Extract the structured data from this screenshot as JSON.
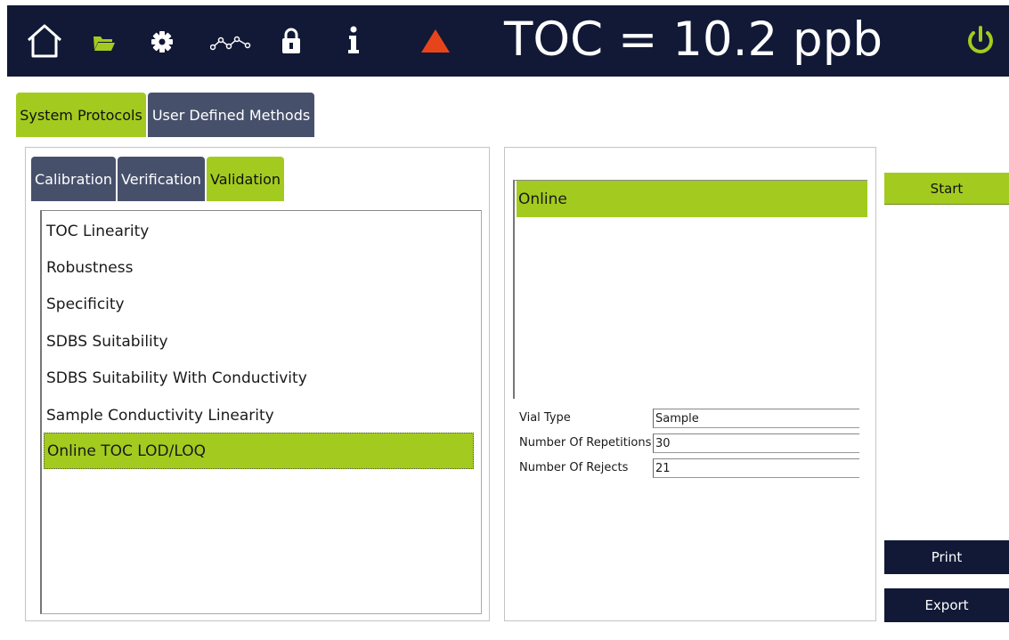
{
  "header": {
    "title": "TOC = 10.2 ppb",
    "icons": [
      "home-icon",
      "folder-icon",
      "gear-icon",
      "trend-icon",
      "lock-icon",
      "info-icon",
      "alert-triangle-icon",
      "power-icon"
    ],
    "colors": {
      "bar": "#111936",
      "accent": "#a3cb1f",
      "alert": "#e8441b"
    }
  },
  "main_tabs": [
    {
      "label": "System Protocols",
      "active": true
    },
    {
      "label": "User Defined Methods",
      "active": false
    }
  ],
  "sub_tabs": [
    {
      "label": "Calibration",
      "active": false
    },
    {
      "label": "Verification",
      "active": false
    },
    {
      "label": "Validation",
      "active": true
    }
  ],
  "protocols": [
    {
      "label": "TOC Linearity"
    },
    {
      "label": "Robustness"
    },
    {
      "label": "Specificity"
    },
    {
      "label": "SDBS Suitability"
    },
    {
      "label": "SDBS Suitability With Conductivity"
    },
    {
      "label": "Sample Conductivity Linearity"
    },
    {
      "label": "Online TOC LOD/LOQ",
      "selected": true
    }
  ],
  "methods": [
    {
      "label": "Online",
      "selected": true
    }
  ],
  "params": [
    {
      "label": "Vial Type",
      "value": "Sample"
    },
    {
      "label": "Number Of Repetitions",
      "value": "30"
    },
    {
      "label": "Number Of Rejects",
      "value": "21"
    }
  ],
  "buttons": {
    "start": "Start",
    "print": "Print",
    "export": "Export"
  }
}
